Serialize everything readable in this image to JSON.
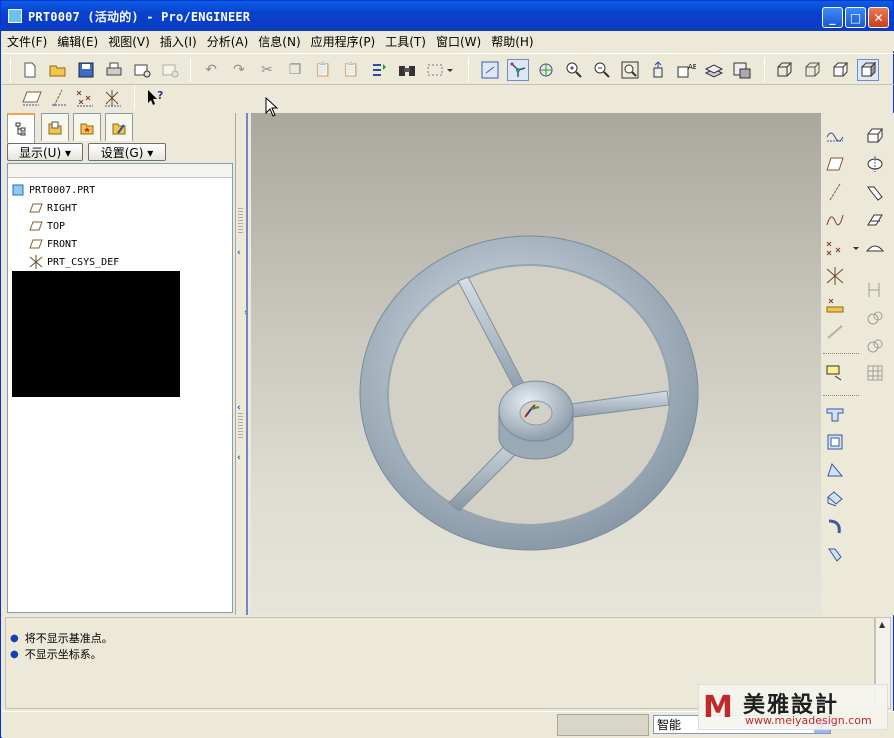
{
  "window": {
    "title": "PRT0007 (活动的) - Pro/ENGINEER",
    "minimize": "_",
    "maximize": "□",
    "close": "✕"
  },
  "menu": [
    "文件(F)",
    "编辑(E)",
    "视图(V)",
    "插入(I)",
    "分析(A)",
    "信息(N)",
    "应用程序(P)",
    "工具(T)",
    "窗口(W)",
    "帮助(H)"
  ],
  "toolbar_icons": [
    "new-icon",
    "open-icon",
    "save-icon",
    "print-icon",
    "email-icon",
    "email-disabled-icon",
    "undo-icon",
    "redo-icon",
    "cut-icon",
    "copy-icon",
    "paste-icon",
    "paste-special-icon",
    "regenerate-icon",
    "find-icon",
    "select-box-icon",
    "repaint-icon",
    "spin-center-icon",
    "orient-icon",
    "zoom-in-icon",
    "zoom-out-icon",
    "refit-icon",
    "reorient-icon",
    "view-list-icon",
    "layers-icon",
    "view-manager-icon",
    "wireframe-icon",
    "hidden-line-icon",
    "no-hidden-icon",
    "shading-icon"
  ],
  "datum_toolbar": [
    "datum-plane-display-icon",
    "datum-axis-display-icon",
    "datum-point-display-icon",
    "coordinate-system-display-icon",
    "help-whats-this-icon"
  ],
  "nav": {
    "tabs": [
      "model-tree-tab",
      "folder-browser-tab",
      "favorites-tab",
      "connections-tab"
    ],
    "show_button": "显示(U) ▾",
    "settings_button": "设置(G) ▾"
  },
  "tree": {
    "root": "PRT0007.PRT",
    "items": [
      {
        "label": "RIGHT",
        "icon": "datum-plane-icon"
      },
      {
        "label": "TOP",
        "icon": "datum-plane-icon"
      },
      {
        "label": "FRONT",
        "icon": "datum-plane-icon"
      },
      {
        "label": "PRT_CSYS_DEF",
        "icon": "coordinate-system-icon"
      }
    ]
  },
  "messages": [
    "将不显示基准点。",
    "不显示坐标系。"
  ],
  "status": {
    "filter_value": "智能"
  },
  "watermark": {
    "logo": "M",
    "title": "美雅設計",
    "url": "www.meiyadesign.com"
  },
  "colors": {
    "titlebar": "#0a4bd6",
    "model": "#b7c4cf",
    "viewport_top": "#a9a79e",
    "viewport_bottom": "#e6e5da"
  }
}
